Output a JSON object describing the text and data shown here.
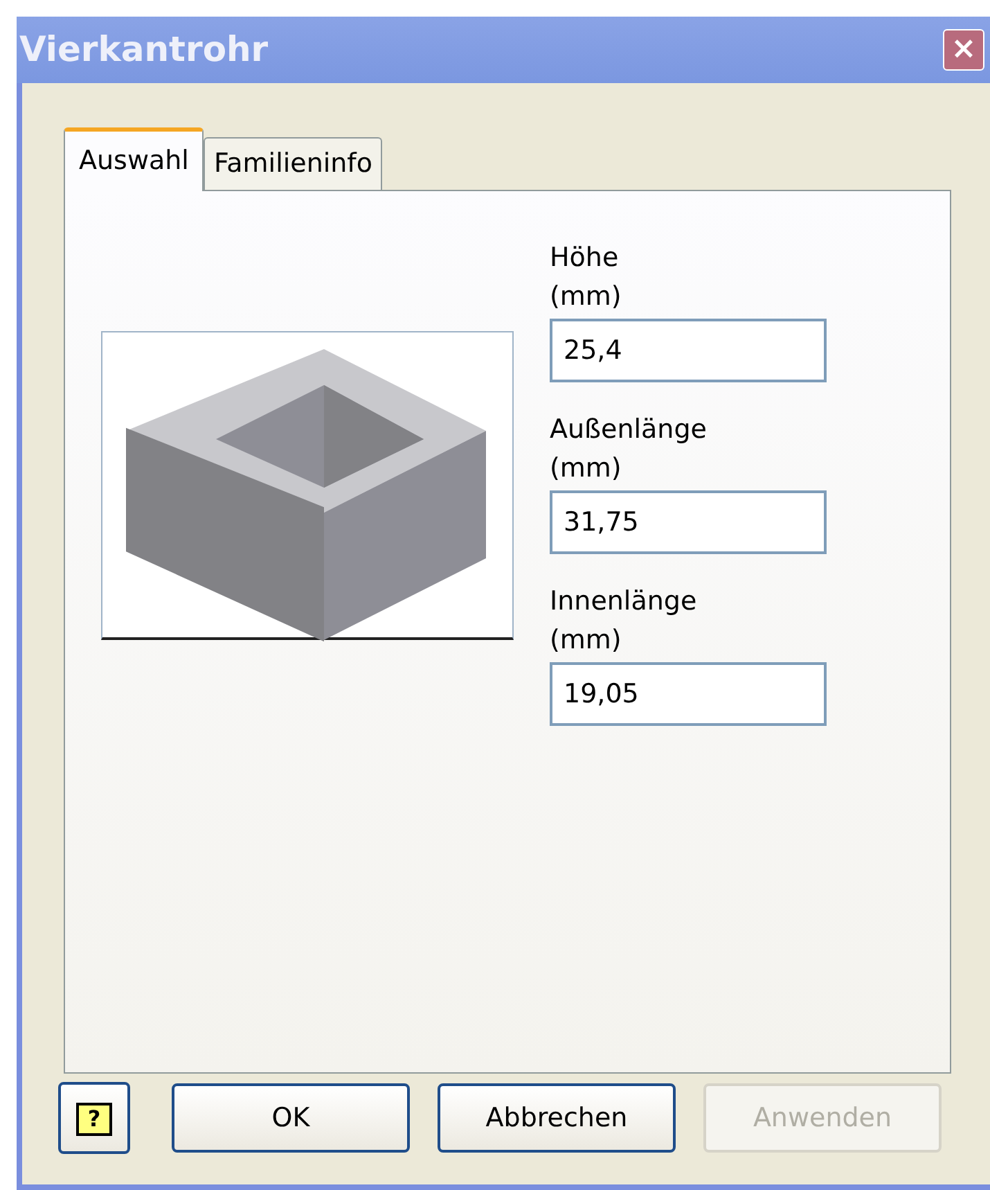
{
  "window": {
    "title": "Vierkantrohr",
    "close": "×"
  },
  "tabs": [
    {
      "label": "Auswahl",
      "selected": true
    },
    {
      "label": "Familieninfo",
      "selected": false
    }
  ],
  "fields": [
    {
      "label": "Höhe",
      "unit": "(mm)",
      "value": "25,4"
    },
    {
      "label": "Außenlänge",
      "unit": "(mm)",
      "value": "31,75"
    },
    {
      "label": "Innenlänge",
      "unit": "(mm)",
      "value": "19,05"
    }
  ],
  "help": "?",
  "buttons": [
    {
      "label": "OK",
      "disabled": false
    },
    {
      "label": "Abbrechen",
      "disabled": false
    },
    {
      "label": "Anwenden",
      "disabled": true
    }
  ]
}
